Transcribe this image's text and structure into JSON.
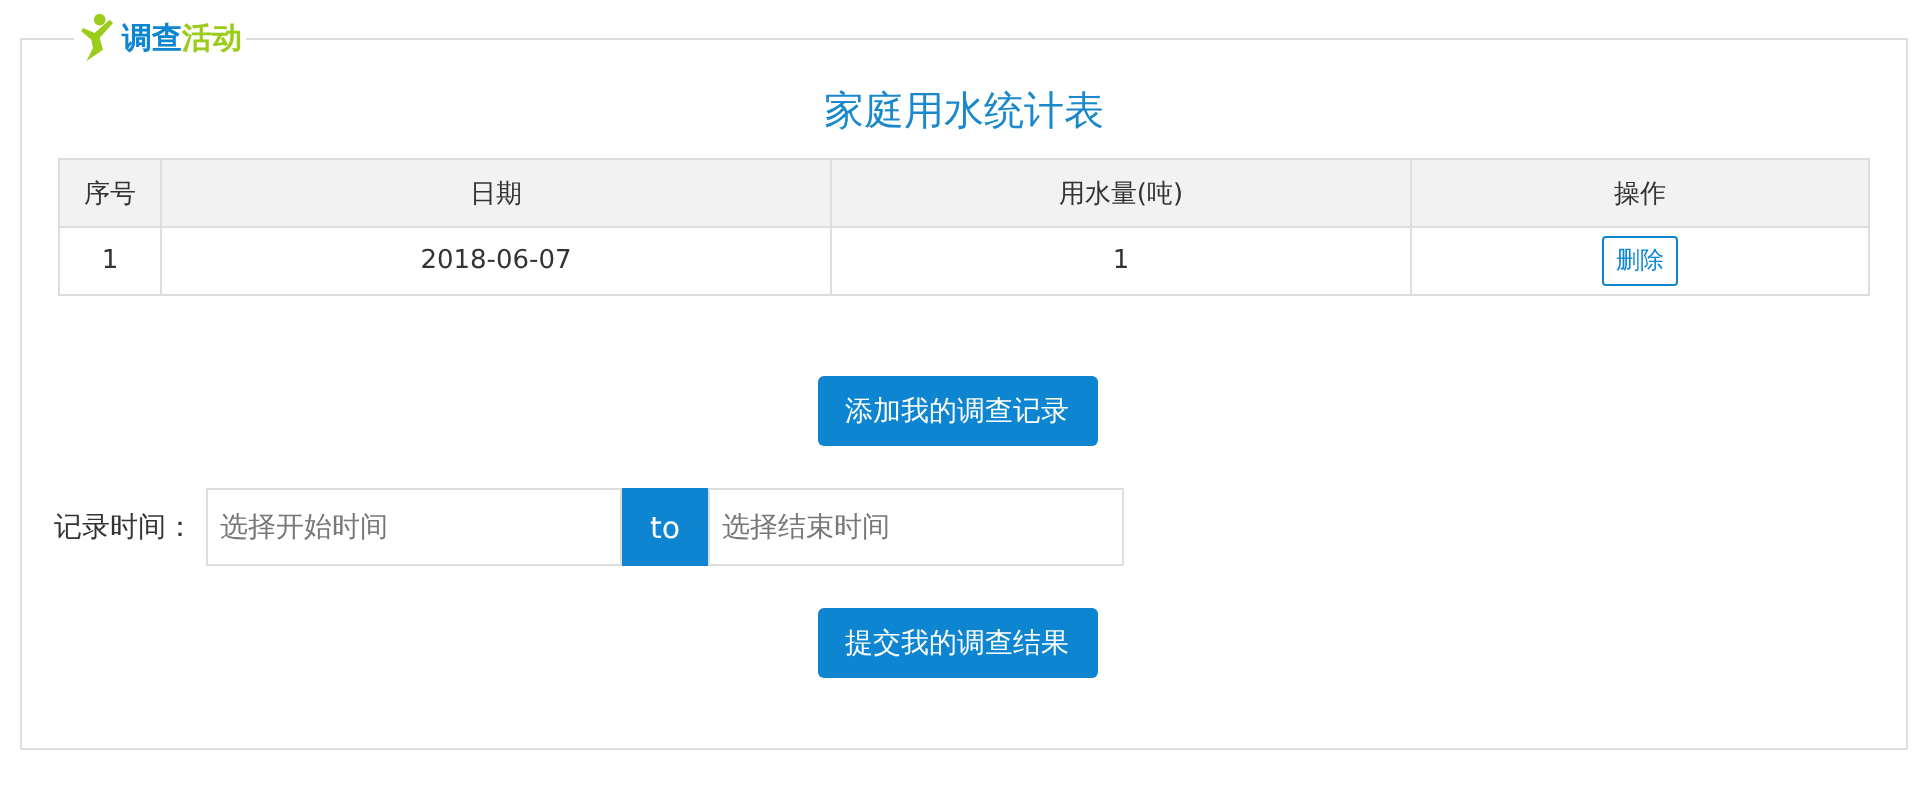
{
  "section_title": [
    "调查",
    "活动"
  ],
  "table": {
    "title": "家庭用水统计表",
    "columns": [
      "序号",
      "日期",
      "用水量(吨)",
      "操作"
    ],
    "rows": [
      {
        "cells": [
          "1",
          "2018-06-07",
          "1"
        ],
        "action": "删除"
      }
    ]
  },
  "add_button": "添加我的调查记录",
  "date_range": {
    "label": "记录时间：",
    "start": {
      "placeholder": "选择开始时间"
    },
    "separator": "to",
    "end": {
      "placeholder": "选择结束时间"
    }
  },
  "submit_button": "提交我的调查结果"
}
